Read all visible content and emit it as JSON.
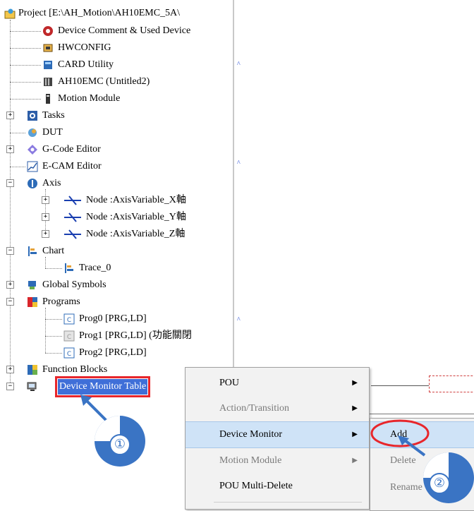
{
  "tree": {
    "root_label": "Project [E:\\AH_Motion\\AH10EMC_5A\\",
    "items": [
      {
        "label": "Device Comment & Used Device",
        "icon": "device-comment-icon"
      },
      {
        "label": "HWCONFIG",
        "icon": "hwconfig-icon"
      },
      {
        "label": "CARD Utility",
        "icon": "card-utility-icon"
      },
      {
        "label": "AH10EMC  (Untitled2)",
        "icon": "plc-icon"
      },
      {
        "label": "Motion Module",
        "icon": "motion-module-icon"
      },
      {
        "label": "Tasks",
        "icon": "tasks-icon"
      },
      {
        "label": "DUT",
        "icon": "dut-icon"
      },
      {
        "label": "G-Code Editor",
        "icon": "gcode-editor-icon"
      },
      {
        "label": "E-CAM Editor",
        "icon": "ecam-editor-icon"
      },
      {
        "label": "Axis",
        "icon": "axis-icon"
      },
      {
        "label": "Node :AxisVariable_X軸",
        "icon": "node-icon"
      },
      {
        "label": "Node :AxisVariable_Y軸",
        "icon": "node-icon"
      },
      {
        "label": "Node :AxisVariable_Z軸",
        "icon": "node-icon"
      },
      {
        "label": "Chart",
        "icon": "chart-icon"
      },
      {
        "label": "Trace_0",
        "icon": "trace-icon"
      },
      {
        "label": "Global Symbols",
        "icon": "global-symbols-icon"
      },
      {
        "label": "Programs",
        "icon": "programs-icon"
      },
      {
        "label": "Prog0 [PRG,LD]",
        "icon": "program-icon"
      },
      {
        "label": "Prog1 [PRG,LD] (功能關閉",
        "icon": "program-disabled-icon"
      },
      {
        "label": "Prog2 [PRG,LD]",
        "icon": "program-icon"
      },
      {
        "label": "Function Blocks",
        "icon": "function-blocks-icon"
      },
      {
        "label": "Device Monitor Table",
        "icon": "device-monitor-icon"
      }
    ]
  },
  "context_menu": {
    "items": [
      {
        "label": "POU",
        "disabled": false,
        "has_submenu": true
      },
      {
        "label": "Action/Transition",
        "disabled": true,
        "has_submenu": true
      },
      {
        "label": "Device Monitor",
        "disabled": false,
        "has_submenu": true,
        "highlighted": true
      },
      {
        "label": "Motion Module",
        "disabled": true,
        "has_submenu": true
      },
      {
        "label": "POU Multi-Delete",
        "disabled": false,
        "has_submenu": false
      }
    ]
  },
  "submenu": {
    "items": [
      {
        "label": "Add",
        "disabled": false,
        "highlighted": true
      },
      {
        "label": "Delete",
        "disabled": true
      },
      {
        "label": "Rename",
        "disabled": true
      }
    ]
  },
  "callouts": [
    "①",
    "②"
  ],
  "colors": {
    "selection": "#3f6fd8",
    "annotation_red": "#e8262b",
    "annotation_blue": "#3a74c4",
    "menu_highlight": "#cfe3f7"
  }
}
